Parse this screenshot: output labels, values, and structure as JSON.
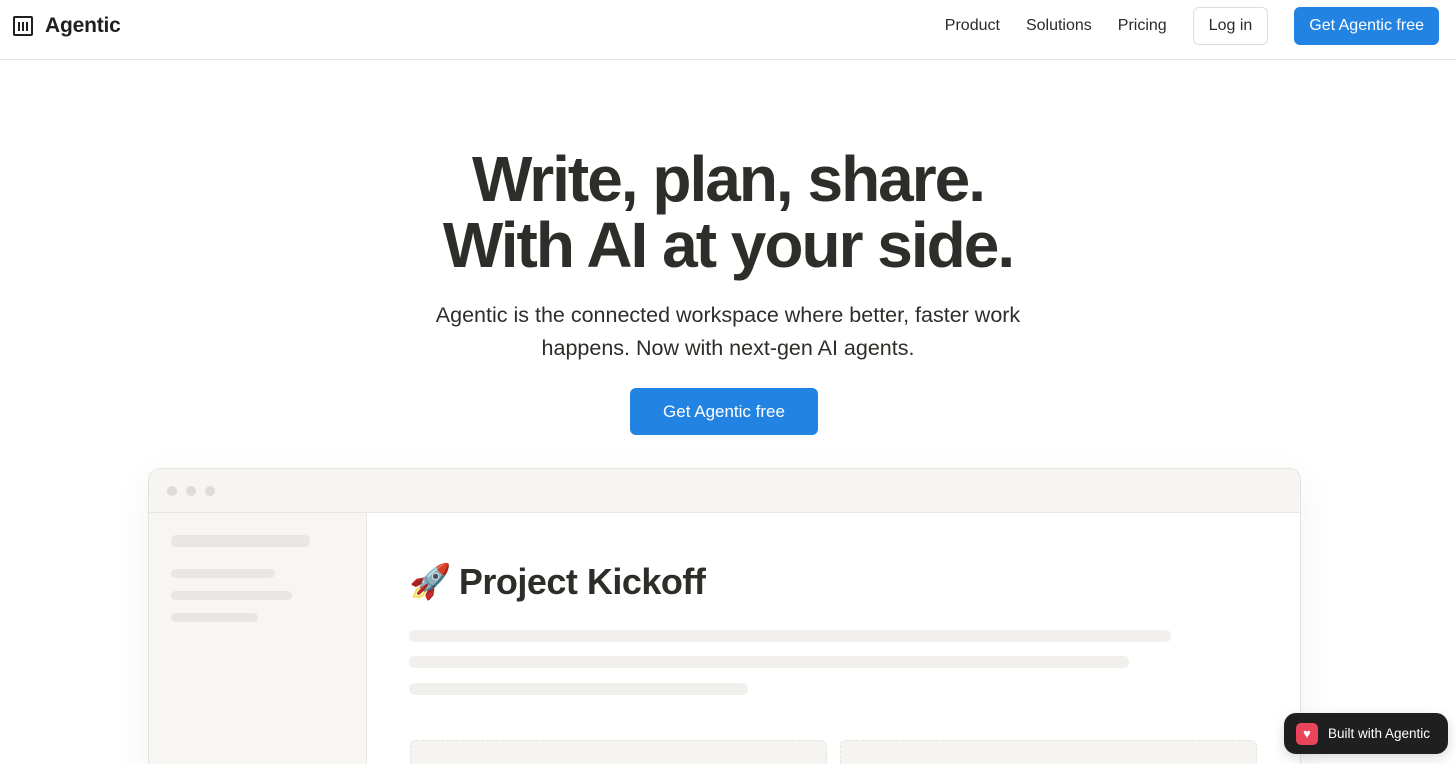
{
  "brand": {
    "name": "Agentic",
    "logo_icon": "agentic-logo-icon"
  },
  "nav": {
    "links": [
      "Product",
      "Solutions",
      "Pricing"
    ],
    "login": "Log in",
    "cta": "Get Agentic free"
  },
  "hero": {
    "title_line1": "Write, plan, share.",
    "title_line2": "With AI at your side.",
    "subtitle_line1": "Agentic is the connected workspace where better, faster work",
    "subtitle_line2": "happens. Now with next-gen AI agents.",
    "cta": "Get Agentic free"
  },
  "preview": {
    "doc_icon": "🚀",
    "doc_title": "Project Kickoff"
  },
  "badge": {
    "label": "Built with Agentic",
    "icon": "heart-icon"
  },
  "colors": {
    "accent": "#2383e2",
    "text": "#2e2d29",
    "badge_bg": "#1f1f1f",
    "badge_icon": "#e9445a"
  }
}
